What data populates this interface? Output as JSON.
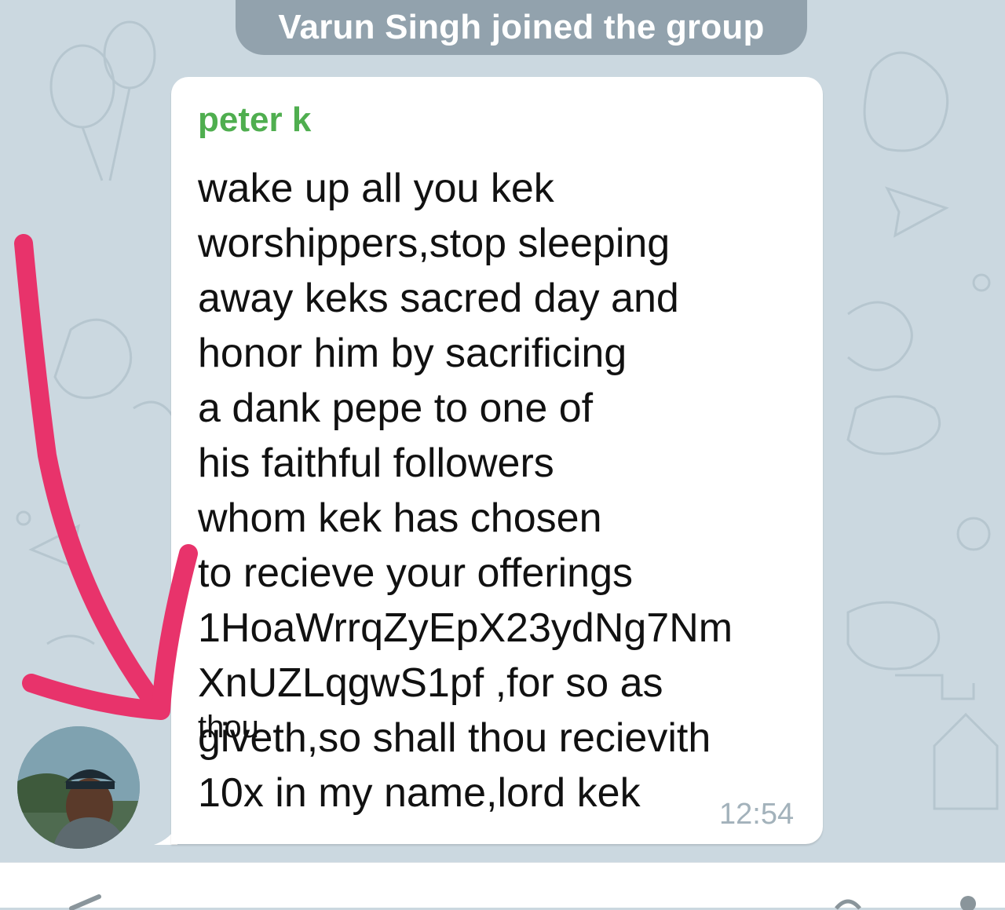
{
  "service_message": "Varun Singh joined the group",
  "message": {
    "sender": "peter k",
    "text": "wake up all you kek\nworshippers,stop sleeping\naway keks sacred day and\nhonor him by sacrificing\na dank pepe to one of\nhis faithful followers\nwhom kek has chosen\nto recieve your offerings\n1HoaWrrqZyEpX23ydNg7Nm\nXnUZLqgwS1pf    ,for so as\ngiveth,so shall thou recievith\n10x in my name,lord kek",
    "overlap_word": "thou",
    "time": "12:54"
  },
  "avatar_icon": "user-avatar-photo",
  "annotation": {
    "shape": "hand-drawn-arrow",
    "color": "#e8336b"
  },
  "icons": [
    "attach-icon",
    "mic-icon"
  ],
  "colors": {
    "sender_name": "#4fae4f",
    "background": "#cbd8e0",
    "service_pill": "#7c8e98"
  }
}
